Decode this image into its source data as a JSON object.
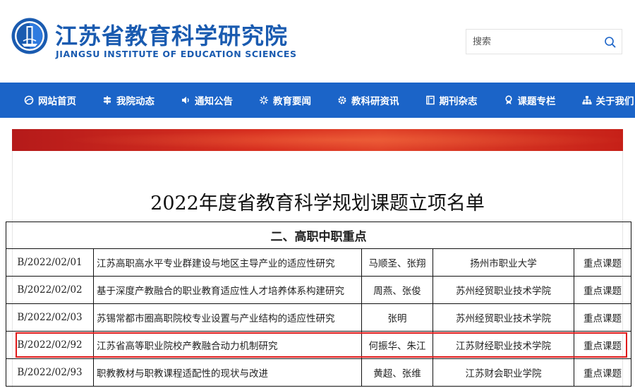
{
  "header": {
    "logo_cn": "江苏省教育科学研究院",
    "logo_en": "JIANGSU INSTITUTE OF EDUCATION SCIENCES",
    "search_placeholder": "搜索"
  },
  "nav": [
    {
      "label": "网站首页",
      "icon": "browser-icon"
    },
    {
      "label": "我院动态",
      "icon": "signpost-icon"
    },
    {
      "label": "通知公告",
      "icon": "speaker-icon"
    },
    {
      "label": "教育要闻",
      "icon": "sparkle-icon"
    },
    {
      "label": "教科研资讯",
      "icon": "gear-icon"
    },
    {
      "label": "期刊杂志",
      "icon": "book-icon"
    },
    {
      "label": "课题专栏",
      "icon": "medal-icon"
    },
    {
      "label": "关于我们",
      "icon": "sitemap-icon"
    }
  ],
  "colors": {
    "brand_blue": "#1a5bb0",
    "nav_bg": "#1b64c8",
    "banner_red": "#d83020",
    "highlight_red": "#e01818"
  },
  "page_title": "2022年度省教育科学规划课题立项名单",
  "table": {
    "section_title": "二、高职中职重点",
    "rows": [
      {
        "code": "B/2022/02/01",
        "title": "江苏高职高水平专业群建设与地区主导产业的适应性研究",
        "people": "马顺圣、张翔",
        "org": "扬州市职业大学",
        "type": "重点课题"
      },
      {
        "code": "B/2022/02/02",
        "title": "基于深度产教融合的职业教育适应性人才培养体系构建研究",
        "people": "周燕、张俊",
        "org": "苏州经贸职业技术学院",
        "type": "重点课题"
      },
      {
        "code": "B/2022/02/03",
        "title": "苏锡常都市圈高职院校专业设置与产业结构的适应性研究",
        "people": "张明",
        "org": "苏州经贸职业技术学院",
        "type": "重点课题"
      },
      {
        "code": "B/2022/02/92",
        "title": "江苏省高等职业院校产教融合动力机制研究",
        "people": "何振华、朱江",
        "org": "江苏财经职业技术学院",
        "type": "重点课题"
      },
      {
        "code": "B/2022/02/93",
        "title": "职教教材与职教课程适配性的现状与改进",
        "people": "黄超、张维",
        "org": "江苏财会职业学院",
        "type": "重点课题"
      }
    ]
  }
}
